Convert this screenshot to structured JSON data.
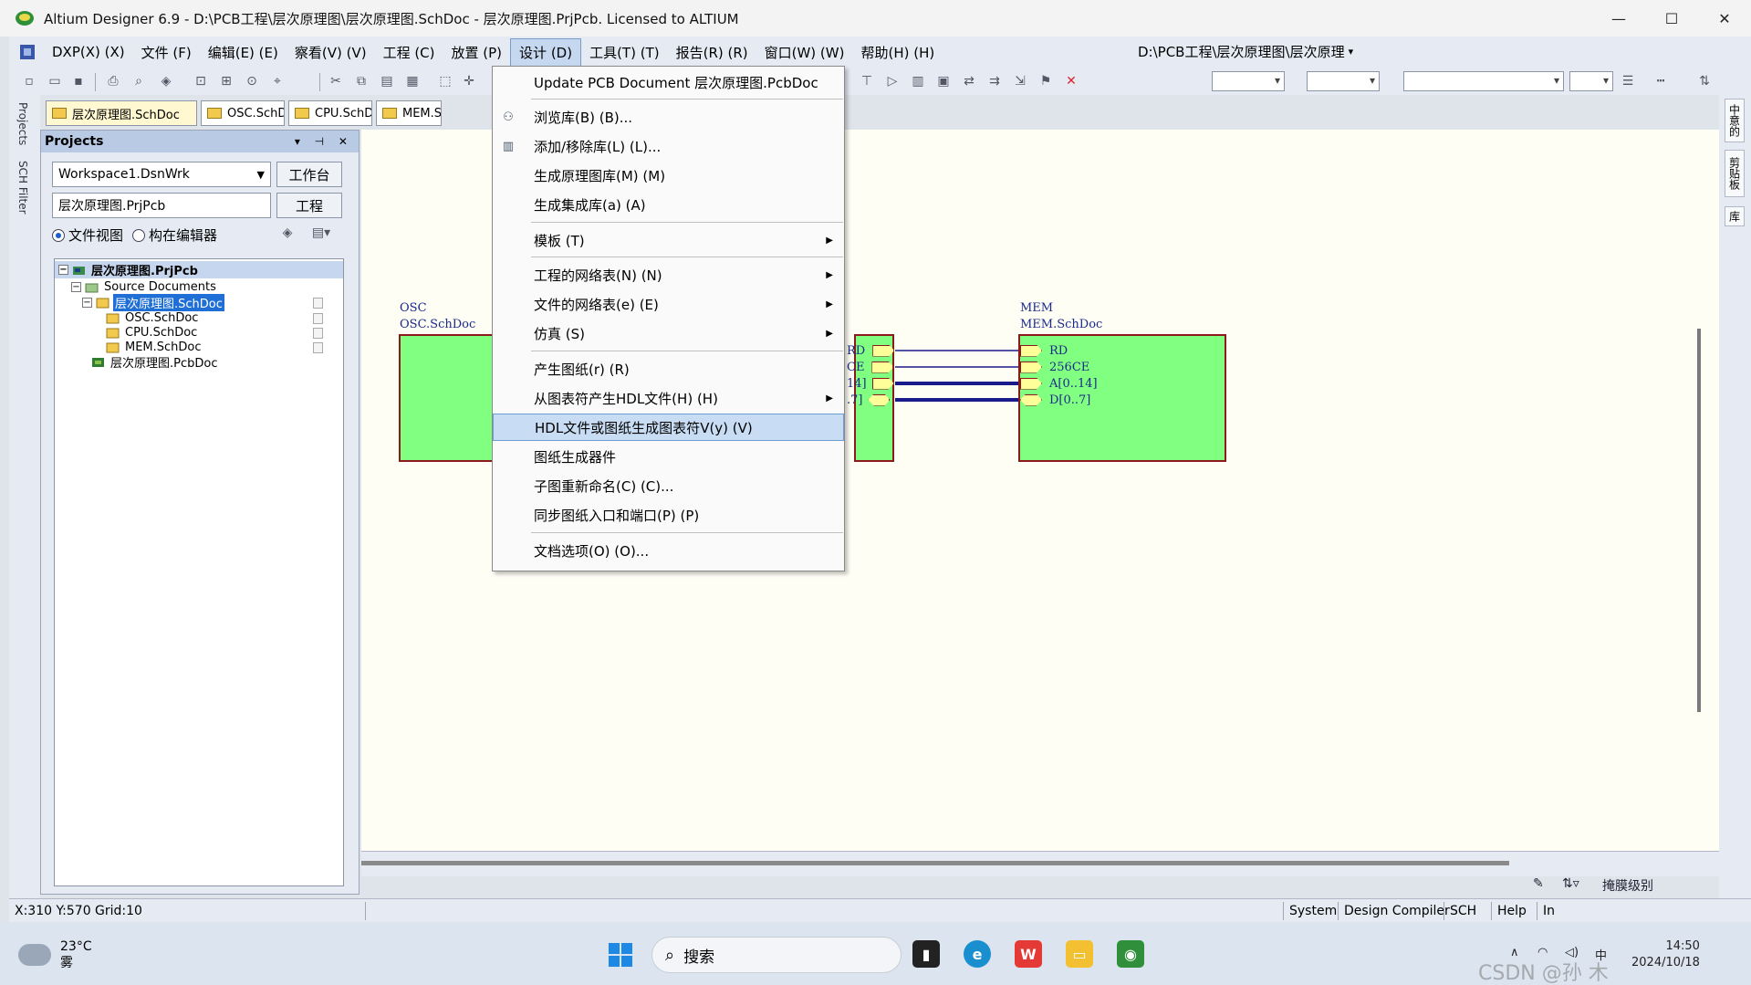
{
  "window": {
    "title": "Altium Designer 6.9 - D:\\PCB工程\\层次原理图\\层次原理图.SchDoc - 层次原理图.PrjPcb. Licensed to ALTIUM",
    "minimize": "—",
    "maximize": "☐",
    "close": "✕"
  },
  "menubar": [
    "DXP(X) (X)",
    "文件 (F)",
    "编辑(E) (E)",
    "察看(V) (V)",
    "工程 (C)",
    "放置 (P)",
    "设计 (D)",
    "工具(T) (T)",
    "报告(R) (R)",
    "窗口(W) (W)",
    "帮助(H) (H)"
  ],
  "path_combo": "D:\\PCB工程\\层次原理图\\层次原理",
  "side_tabs": [
    "Projects",
    "SCH Filter"
  ],
  "doc_tabs": [
    "层次原理图.SchDoc",
    "OSC.SchDoc",
    "CPU.SchDoc",
    "MEM.SchDoc"
  ],
  "projects": {
    "title": "Projects",
    "workspace": "Workspace1.DsnWrk",
    "workspace_btn": "工作台",
    "project": "层次原理图.PrjPcb",
    "project_btn": "工程",
    "radio_file": "文件视图",
    "radio_struct": "构在编辑器",
    "tree": [
      {
        "label": "层次原理图.PrjPcb"
      },
      {
        "label": "Source Documents"
      },
      {
        "label": "层次原理图.SchDoc"
      },
      {
        "label": "OSC.SchDoc"
      },
      {
        "label": "CPU.SchDoc"
      },
      {
        "label": "MEM.SchDoc"
      },
      {
        "label": "层次原理图.PcbDoc"
      }
    ]
  },
  "schematic": {
    "osc": {
      "designator": "OSC",
      "file": "OSC.SchDoc"
    },
    "mem": {
      "designator": "MEM",
      "file": "MEM.SchDoc"
    },
    "cpu_ports": [
      "RD",
      "CE",
      "14]",
      ".7]"
    ],
    "mem_ports": [
      "RD",
      "256CE",
      "A[0..14]",
      "D[0..7]"
    ],
    "wire_color": "#1a1a8a",
    "sheet_color": "#80ff80"
  },
  "design_menu": {
    "items": [
      {
        "label": "Update PCB Document 层次原理图.PcbDoc"
      },
      {
        "label": "浏览库(B) (B)..."
      },
      {
        "label": "添加/移除库(L) (L)..."
      },
      {
        "label": "生成原理图库(M) (M)"
      },
      {
        "label": "生成集成库(a) (A)"
      },
      {
        "label": "模板 (T)"
      },
      {
        "label": "工程的网络表(N) (N)"
      },
      {
        "label": "文件的网络表(e) (E)"
      },
      {
        "label": "仿真 (S)"
      },
      {
        "label": "产生图纸(r) (R)"
      },
      {
        "label": "从图表符产生HDL文件(H) (H)"
      },
      {
        "label": "HDL文件或图纸生成图表符V(y) (V)"
      },
      {
        "label": "图纸生成器件"
      },
      {
        "label": "子图重新命名(C) (C)..."
      },
      {
        "label": "同步图纸入口和端口(P) (P)"
      },
      {
        "label": "文档选项(O) (O)..."
      }
    ]
  },
  "canvas_bottom": {
    "mask_label": "掩膜级别"
  },
  "right_tabs": [
    "中意的",
    "剪贴板",
    "库"
  ],
  "status": {
    "coords": "X:310 Y:570",
    "grid": "Grid:10",
    "panels": [
      "System",
      "Design Compiler",
      "SCH",
      "Help",
      "In"
    ]
  },
  "taskbar": {
    "temp": "23°C",
    "weather": "雾",
    "search": "搜索",
    "time": "14:50",
    "date": "2024/10/18",
    "ime": "中",
    "watermark": "CSDN @孙 木"
  }
}
